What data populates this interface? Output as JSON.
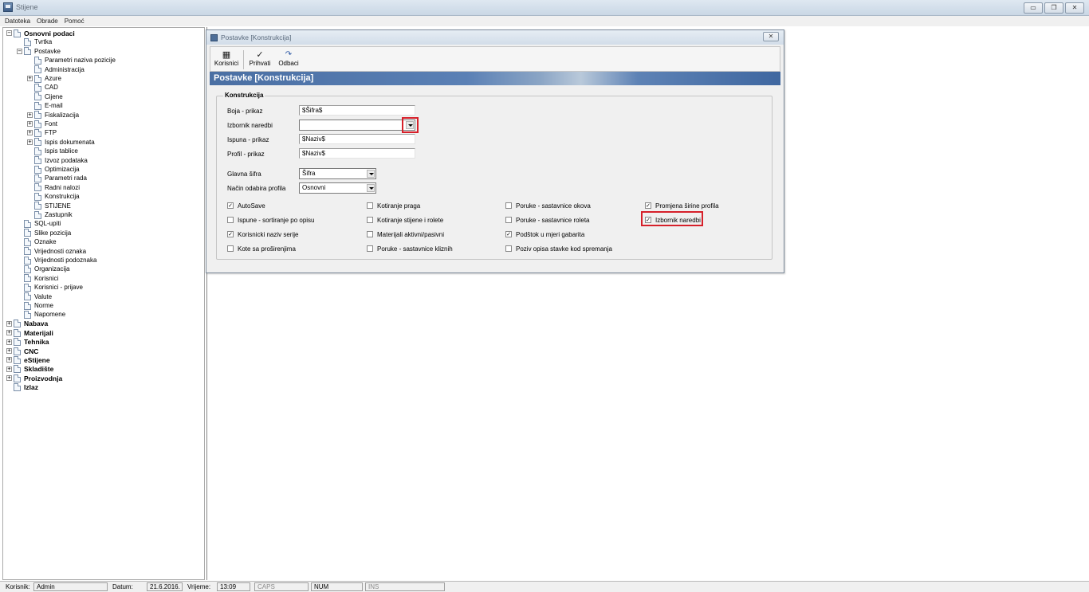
{
  "window": {
    "title": "Stijene",
    "minimize_glyph": "▭",
    "restore_glyph": "❐",
    "close_glyph": "✕"
  },
  "menu": [
    "Datoteka",
    "Obrade",
    "Pomoć"
  ],
  "tree": [
    {
      "label": "Osnovni podaci",
      "level": 0,
      "expander": "−",
      "bold": true
    },
    {
      "label": "Tvrtka",
      "level": 1,
      "expander": "",
      "bold": false
    },
    {
      "label": "Postavke",
      "level": 1,
      "expander": "−",
      "bold": false
    },
    {
      "label": "Parametri naziva pozicije",
      "level": 2,
      "expander": "",
      "bold": false
    },
    {
      "label": "Administracija",
      "level": 2,
      "expander": "",
      "bold": false
    },
    {
      "label": "Azure",
      "level": 2,
      "expander": "+",
      "bold": false
    },
    {
      "label": "CAD",
      "level": 2,
      "expander": "",
      "bold": false
    },
    {
      "label": "Cijene",
      "level": 2,
      "expander": "",
      "bold": false
    },
    {
      "label": "E-mail",
      "level": 2,
      "expander": "",
      "bold": false
    },
    {
      "label": "Fiskalizacija",
      "level": 2,
      "expander": "+",
      "bold": false
    },
    {
      "label": "Font",
      "level": 2,
      "expander": "+",
      "bold": false
    },
    {
      "label": "FTP",
      "level": 2,
      "expander": "+",
      "bold": false
    },
    {
      "label": "Ispis dokumenata",
      "level": 2,
      "expander": "+",
      "bold": false
    },
    {
      "label": "Ispis tablice",
      "level": 2,
      "expander": "",
      "bold": false
    },
    {
      "label": "Izvoz podataka",
      "level": 2,
      "expander": "",
      "bold": false
    },
    {
      "label": "Optimizacija",
      "level": 2,
      "expander": "",
      "bold": false
    },
    {
      "label": "Parametri rada",
      "level": 2,
      "expander": "",
      "bold": false
    },
    {
      "label": "Radni nalozi",
      "level": 2,
      "expander": "",
      "bold": false
    },
    {
      "label": "Konstrukcija",
      "level": 2,
      "expander": "",
      "bold": false
    },
    {
      "label": "STIJENE",
      "level": 2,
      "expander": "",
      "bold": false
    },
    {
      "label": "Zastupnik",
      "level": 2,
      "expander": "",
      "bold": false
    },
    {
      "label": "SQL-upiti",
      "level": 1,
      "expander": "",
      "bold": false
    },
    {
      "label": "Slike pozicija",
      "level": 1,
      "expander": "",
      "bold": false
    },
    {
      "label": "Oznake",
      "level": 1,
      "expander": "",
      "bold": false
    },
    {
      "label": "Vrijednosti oznaka",
      "level": 1,
      "expander": "",
      "bold": false
    },
    {
      "label": "Vrijednosti podoznaka",
      "level": 1,
      "expander": "",
      "bold": false
    },
    {
      "label": "Organizacija",
      "level": 1,
      "expander": "",
      "bold": false
    },
    {
      "label": "Korisnici",
      "level": 1,
      "expander": "",
      "bold": false
    },
    {
      "label": "Korisnici - prijave",
      "level": 1,
      "expander": "",
      "bold": false
    },
    {
      "label": "Valute",
      "level": 1,
      "expander": "",
      "bold": false
    },
    {
      "label": "Norme",
      "level": 1,
      "expander": "",
      "bold": false
    },
    {
      "label": "Napomene",
      "level": 1,
      "expander": "",
      "bold": false
    },
    {
      "label": "Nabava",
      "level": 0,
      "expander": "+",
      "bold": true
    },
    {
      "label": "Materijali",
      "level": 0,
      "expander": "+",
      "bold": true
    },
    {
      "label": "Tehnika",
      "level": 0,
      "expander": "+",
      "bold": true
    },
    {
      "label": "CNC",
      "level": 0,
      "expander": "+",
      "bold": true
    },
    {
      "label": "eStijene",
      "level": 0,
      "expander": "+",
      "bold": true
    },
    {
      "label": "Skladište",
      "level": 0,
      "expander": "+",
      "bold": true
    },
    {
      "label": "Proizvodnja",
      "level": 0,
      "expander": "+",
      "bold": true
    },
    {
      "label": "Izlaz",
      "level": 0,
      "expander": "",
      "bold": true
    }
  ],
  "dialog": {
    "title": "Postavke  [Konstrukcija]",
    "close_glyph": "✕",
    "toolbar": {
      "korisnici_icon": "▦",
      "korisnici_label": "Korisnici",
      "prihvati_icon": "✓",
      "prihvati_label": "Prihvati",
      "odbaci_icon": "↷",
      "odbaci_label": "Odbaci"
    },
    "banner": "Postavke  [Konstrukcija]",
    "group_title": "Konstrukcija",
    "fields": {
      "boja_label": "Boja - prikaz",
      "boja_value": "$Šifra$",
      "izbornik_label": "Izbornik naredbi",
      "izbornik_value": "",
      "ispuna_label": "Ispuna - prikaz",
      "ispuna_value": "$Naziv$",
      "profil_label": "Profil - prikaz",
      "profil_value": "$Naziv$",
      "glavna_label": "Glavna šifra",
      "glavna_value": "Šifra",
      "nacin_label": "Način odabira profila",
      "nacin_value": "Osnovni"
    },
    "checkboxes": [
      {
        "label": "AutoSave",
        "checked": true
      },
      {
        "label": "Ispune - sortiranje po opisu",
        "checked": false
      },
      {
        "label": "Korisnicki naziv serije",
        "checked": true
      },
      {
        "label": "Kote sa proširenjima",
        "checked": false
      },
      {
        "label": "Kotiranje praga",
        "checked": false
      },
      {
        "label": "Kotiranje stijene i rolete",
        "checked": false
      },
      {
        "label": "Materijali aktivni/pasivni",
        "checked": false
      },
      {
        "label": "Poruke - sastavnice kliznih",
        "checked": false
      },
      {
        "label": "Poruke - sastavnice okova",
        "checked": false
      },
      {
        "label": "Poruke - sastavnice roleta",
        "checked": false
      },
      {
        "label": "Podštok u mjeri gabarita",
        "checked": true
      },
      {
        "label": "Poziv opisa stavke kod spremanja",
        "checked": false
      },
      {
        "label": "Promjena širine profila",
        "checked": true
      },
      {
        "label": "Izbornik naredbi",
        "checked": true
      }
    ]
  },
  "status": {
    "korisnik_label": "Korisnik:",
    "korisnik_value": "Admin",
    "datum_label": "Datum:",
    "datum_value": "21.6.2016.",
    "vrijeme_label": "Vrijeme:",
    "vrijeme_value": "13:09",
    "caps": "CAPS",
    "num": "NUM",
    "ins": "INS"
  },
  "colors": {
    "banner": "#4a6fa3",
    "highlight": "#d6202a"
  }
}
